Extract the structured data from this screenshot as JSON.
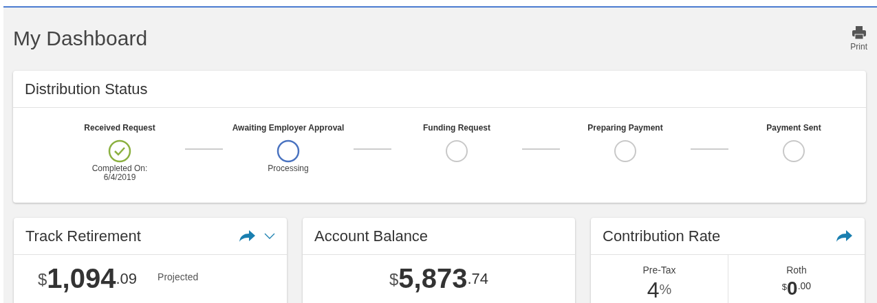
{
  "page": {
    "title": "My Dashboard",
    "print_label": "Print"
  },
  "distribution_status": {
    "title": "Distribution Status",
    "steps": [
      {
        "label": "Received Request",
        "completed": true,
        "current": false,
        "note": "Completed On:\n6/4/2019"
      },
      {
        "label": "Awaiting Employer Approval",
        "completed": false,
        "current": true,
        "note": "Processing"
      },
      {
        "label": "Funding Request",
        "completed": false,
        "current": false
      },
      {
        "label": "Preparing Payment",
        "completed": false,
        "current": false
      },
      {
        "label": "Payment Sent",
        "completed": false,
        "current": false
      }
    ]
  },
  "track_retirement": {
    "title": "Track Retirement",
    "expanded": false,
    "currency": "$",
    "whole": "1,094",
    "cents": ".09",
    "caption": "Projected"
  },
  "account_balance": {
    "title": "Account Balance",
    "currency": "$",
    "whole": "5,873",
    "cents": ".74"
  },
  "contribution_rate": {
    "title": "Contribution Rate",
    "columns": [
      {
        "label": "Pre-Tax",
        "kind": "percent",
        "whole": "4",
        "unit": "%"
      },
      {
        "label": "Roth",
        "kind": "dollar",
        "currency": "$",
        "whole": "0",
        "cents": ".00"
      }
    ]
  }
}
